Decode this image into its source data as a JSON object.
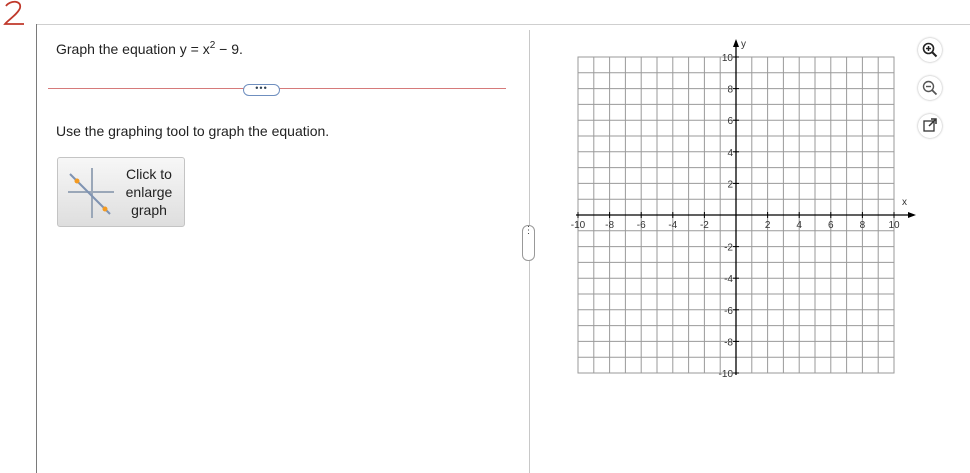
{
  "annotation": {
    "corner_mark": "2"
  },
  "question": {
    "prefix": "Graph the equation y = x",
    "exponent": "2",
    "suffix": " − 9."
  },
  "more_button_label": "•••",
  "instruction": "Use the graphing tool to graph the equation.",
  "enlarge_button": {
    "label_line1": "Click to",
    "label_line2": "enlarge",
    "label_line3": "graph"
  },
  "splitter_handle_label": "⋮",
  "graph": {
    "x_axis_label": "x",
    "y_axis_label": "y",
    "xlim": [
      -10,
      10
    ],
    "ylim": [
      -10,
      10
    ],
    "grid_step": 1,
    "x_tick_labels": [
      "-10",
      "-8",
      "-6",
      "-4",
      "-2",
      "2",
      "4",
      "6",
      "8",
      "10"
    ],
    "y_tick_labels": [
      "10",
      "8",
      "6",
      "4",
      "2",
      "-2",
      "-4",
      "-6",
      "-8",
      "-10"
    ],
    "grid_color": "#9a9a9a",
    "axis_color": "#000000"
  },
  "tools": [
    "zoom-in-icon",
    "zoom-out-icon",
    "popout-icon"
  ],
  "colors": {
    "accent_orange": "#f39a21",
    "corner_mark_red": "#c0392b"
  }
}
